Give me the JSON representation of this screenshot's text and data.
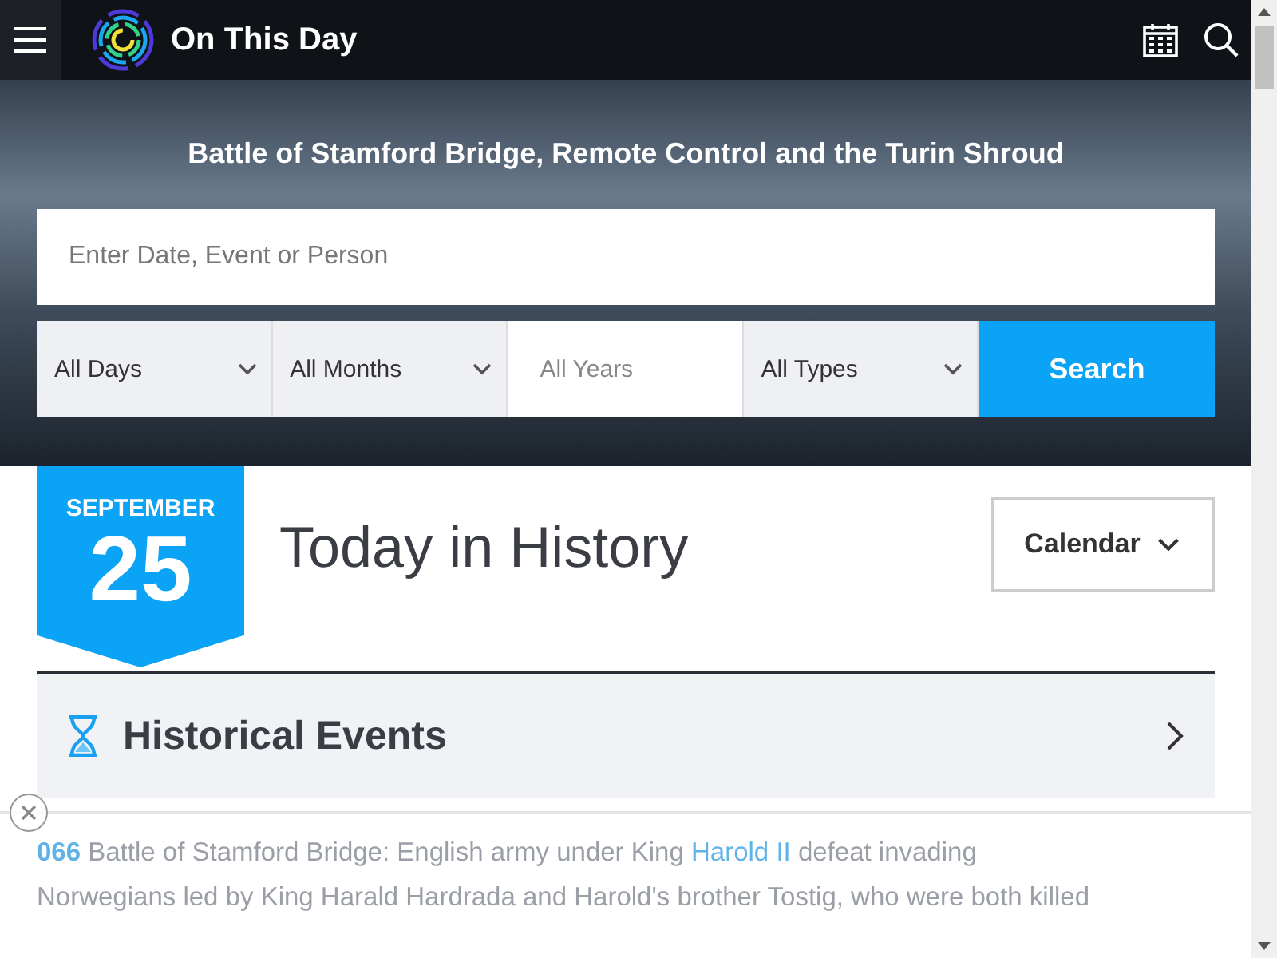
{
  "header": {
    "title": "On This Day"
  },
  "hero": {
    "headline": "Battle of Stamford Bridge, Remote Control and the Turin Shroud",
    "search": {
      "placeholder": "Enter Date, Event or Person"
    },
    "filters": [
      {
        "kind": "select",
        "label": "All Days"
      },
      {
        "kind": "select",
        "label": "All Months"
      },
      {
        "kind": "input",
        "placeholder": "All Years"
      },
      {
        "kind": "select",
        "label": "All Types"
      }
    ],
    "button": "Search"
  },
  "date_badge": {
    "month": "SEPTEMBER",
    "day": "25"
  },
  "page_title": "Today in History",
  "calendar_button": "Calendar",
  "section": {
    "title": "Historical Events",
    "expanded": false
  },
  "event": {
    "year": "066",
    "parts": [
      {
        "kind": "text",
        "text": "Battle of Stamford Bridge: English army under King"
      },
      {
        "kind": "link",
        "text": "Harold II"
      },
      {
        "kind": "text",
        "text": "defeat invading"
      }
    ],
    "line2": "Norwegians led by King Harald Hardrada and Harold's brother Tostig, who were both killed"
  }
}
